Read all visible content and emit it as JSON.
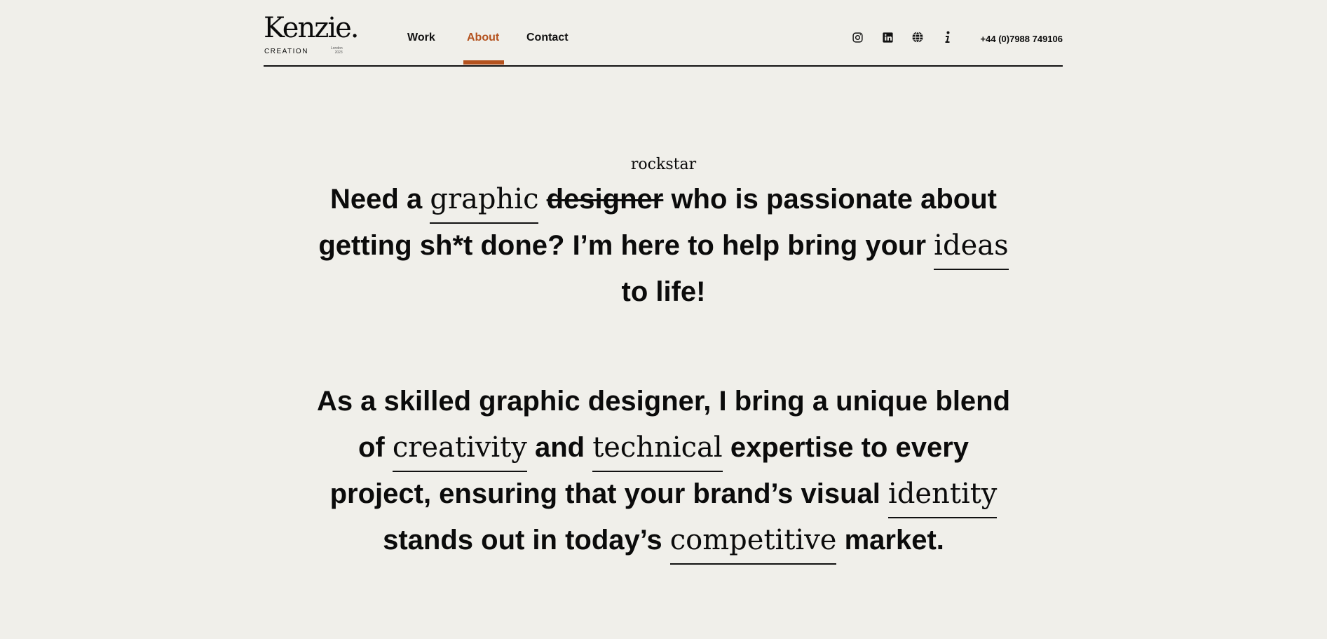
{
  "brand": {
    "name": "Kenzie.",
    "sub": "CREATION",
    "tiny_line1": "London",
    "tiny_line2": "2023"
  },
  "nav": {
    "items": [
      {
        "label": "Work",
        "active": false
      },
      {
        "label": "About",
        "active": true
      },
      {
        "label": "Contact",
        "active": false
      }
    ],
    "accent": "#b4521e"
  },
  "social_icons": [
    "instagram-icon",
    "linkedin-icon",
    "globe-icon",
    "info-icon"
  ],
  "phone": "+44 (0)7988 749106",
  "hero": {
    "annotation": "rockstar",
    "p1": {
      "t1": "Need a ",
      "w1": "graphic",
      "t2": " ",
      "struck": "designer",
      "t3": " who is passionate about getting sh*t done? I’m here to help bring your ",
      "w2": "ideas",
      "t4": " to life!"
    },
    "p2": {
      "t1": "As a skilled graphic designer, I bring a unique blend of ",
      "w1": "creativity",
      "t2": " and ",
      "w2": "technical",
      "t3": " expertise to every project, ensuring that your brand’s visual ",
      "w3": "identity",
      "t4": " stands out in today’s ",
      "w4": "competitive",
      "t5": " market."
    }
  },
  "colors": {
    "background": "#f0efea",
    "text": "#0b0b0b",
    "accent": "#b4521e"
  }
}
